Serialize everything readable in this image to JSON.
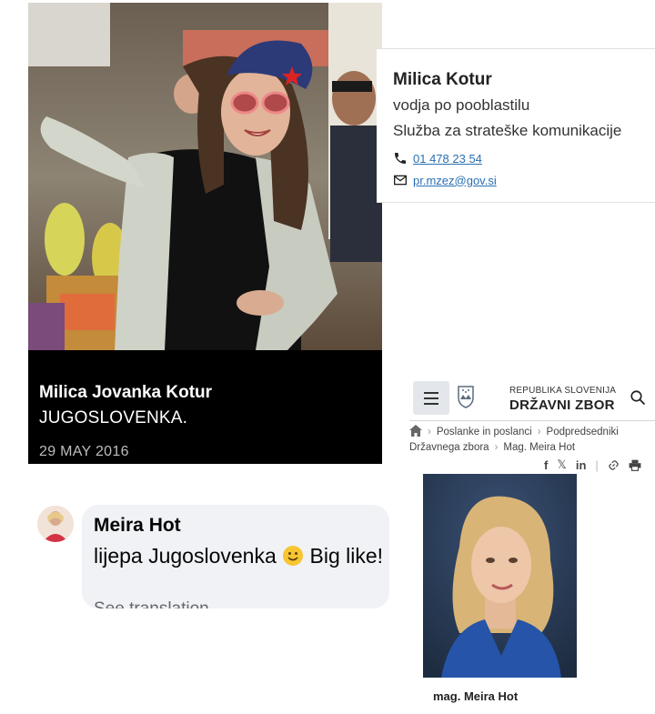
{
  "instagram_post": {
    "author": "Milica Jovanka Kotur",
    "caption": "JUGOSLOVENKA.",
    "date": "29 MAY 2016"
  },
  "contact_card": {
    "name": "Milica Kotur",
    "role": "vodja po pooblastilu",
    "department": "Služba za strateške komunikacije",
    "phone": "01 478 23 54",
    "email": "pr.mzez@gov.si",
    "icons": {
      "phone": "phone-icon",
      "email": "envelope-icon"
    },
    "link_color": "#2a6fb1"
  },
  "facebook_comment": {
    "author": "Meira Hot",
    "text_before_emoji": "lijepa Jugoslovenka ",
    "text_after_emoji": " Big like!",
    "see_translation": "See translation",
    "bubble_color": "#f0f2f5"
  },
  "dz_site": {
    "republic": "REPUBLIKA SLOVENIJA",
    "title": "DRŽAVNI ZBOR",
    "breadcrumb": {
      "item1": "Poslanke in poslanci",
      "item2": "Podpredsedniki Državnega zbora",
      "item3": "Mag. Meira Hot"
    },
    "share_icons": [
      "facebook-icon",
      "x-icon",
      "linkedin-icon",
      "link-icon",
      "print-icon"
    ],
    "portrait_caption": "mag. Meira Hot"
  }
}
